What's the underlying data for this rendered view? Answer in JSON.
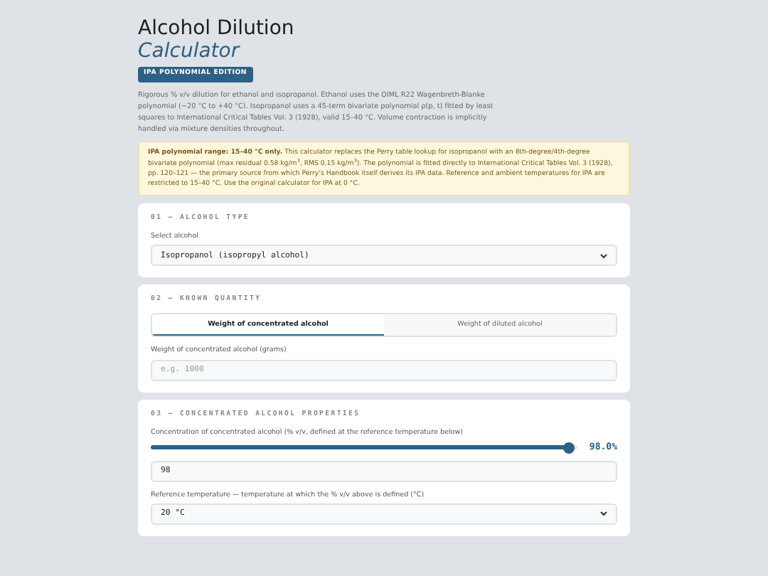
{
  "title": "Alcohol Dilution",
  "subtitle": "Calculator",
  "edition_badge": "IPA POLYNOMIAL EDITION",
  "intro": "Rigorous % v/v dilution for ethanol and isopropanol. Ethanol uses the OIML R22 Wagenbreth-Blanke polynomial (−20 °C to +40 °C). Isopropanol uses a 45-term bivariate polynomial ρ(p, t) fitted by least squares to International Critical Tables Vol. 3 (1928), valid 15–40 °C. Volume contraction is implicitly handled via mixture densities throughout.",
  "notice": "**IPA polynomial range: 15–40 °C only.** This calculator replaces the Perry table lookup for isopropanol with an 8th-degree/4th-degree bivariate polynomial (max residual 0.58 kg/m$^{3}$, RMS 0.15 kg/m$^{3}$). The polynomial is fitted directly to International Critical Tables Vol. 3 (1928), pp. 120–121 — the primary source from which Perry’s Handbook itself derives its IPA data. Reference and ambient temperatures for IPA are restricted to 15–40 °C. Use the original calculator for IPA at 0 °C.",
  "sections": [
    {
      "heading": "01 — ALCOHOL TYPE",
      "fields": [
        {
          "kind": "select",
          "label": "Select alcohol",
          "value": "Isopropanol (isopropyl alcohol)"
        }
      ]
    },
    {
      "heading": "02 — KNOWN QUANTITY",
      "fields": [
        {
          "kind": "tabs",
          "tabs": [
            {
              "label": "Weight of concentrated alcohol",
              "selected": true
            },
            {
              "label": "Weight of diluted alcohol",
              "selected": false
            }
          ]
        },
        {
          "kind": "input",
          "label": "Weight of concentrated alcohol (grams)",
          "placeholder": "e.g. 1000"
        }
      ]
    },
    {
      "heading": "03 — CONCENTRATED ALCOHOL PROPERTIES",
      "fields": [
        {
          "kind": "slider",
          "label": "Concentration of concentrated alcohol (% v/v, defined at the reference temperature below)",
          "level": 0.98,
          "reading": "98.0%"
        },
        {
          "kind": "input",
          "value": "98"
        },
        {
          "kind": "select",
          "label": "Reference temperature — temperature at which the % v/v above is defined (°C)",
          "value": "20 °C"
        }
      ]
    }
  ]
}
